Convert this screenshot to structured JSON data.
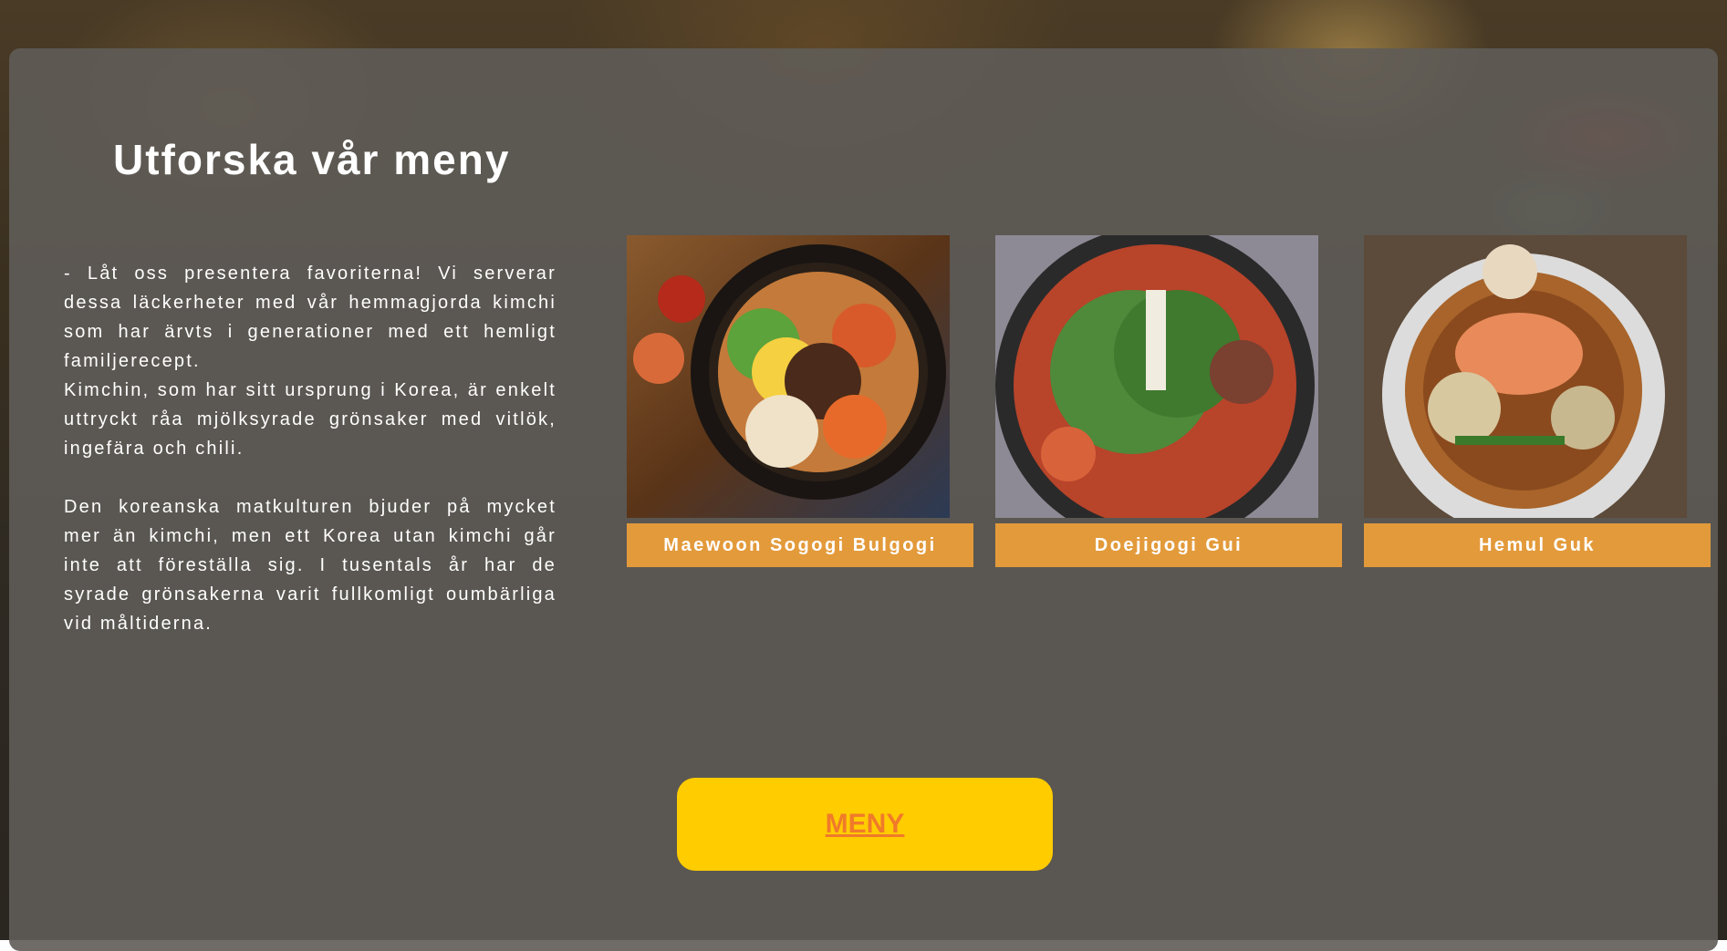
{
  "section": {
    "title": "Utforska vår meny",
    "intro_p1_line1": "- Låt oss presentera favoriterna! Vi serverar dessa läckerheter med vår hemmagjorda kimchi som har ärvts i generationer med ett hemligt familjerecept.",
    "intro_p1_line2": "Kimchin, som har sitt ursprung i Korea, är enkelt uttryckt råa mjölksyrade grönsaker med vitlök, ingefära och chili.",
    "intro_p2": "Den koreanska matkulturen bjuder på mycket mer än kimchi, men ett Korea utan kimchi går inte att föreställa sig. I tusentals år har de syrade grönsakerna varit fullkomligt oumbärliga vid måltiderna."
  },
  "dishes": [
    {
      "name": "Maewoon Sogogi Bulgogi",
      "icon": "bibimbap-photo"
    },
    {
      "name": "Doejigogi Gui",
      "icon": "stew-photo"
    },
    {
      "name": "Hemul Guk",
      "icon": "seafood-soup-photo"
    }
  ],
  "menu_button": {
    "label": "MENY"
  },
  "colors": {
    "accent_orange": "#e39a3b",
    "button_yellow": "#ffcc00",
    "button_text": "#f07a2a"
  }
}
